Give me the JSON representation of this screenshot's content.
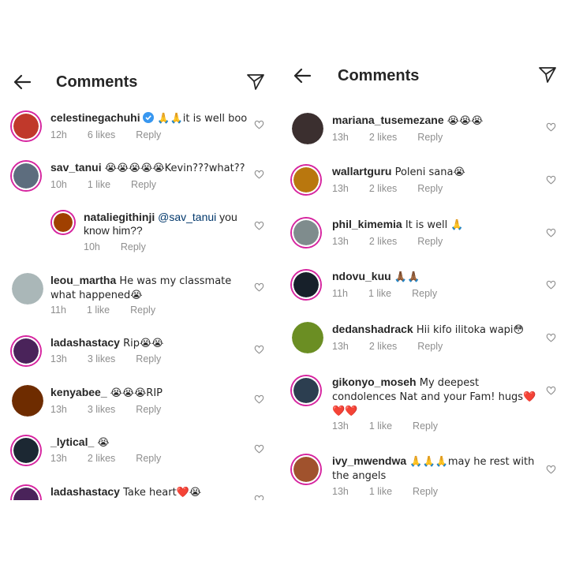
{
  "header": {
    "title": "Comments"
  },
  "left_comments": [
    {
      "user": "celestinegachuhi",
      "verified": true,
      "text": " 🙏🙏it is well boo",
      "time": "12h",
      "likes": "6 likes",
      "reply": "Reply",
      "avatar_color": "#c0392b"
    },
    {
      "user": "sav_tanui",
      "verified": false,
      "text": " 😭😭😭😭😭Kevin???what??",
      "time": "10h",
      "likes": "1 like",
      "reply": "Reply",
      "avatar_color": "#5d6d7e"
    },
    {
      "user": "nataliegithinji",
      "mention": "@sav_tanui",
      "text": " you know him??",
      "time": "10h",
      "likes": "",
      "reply": "Reply",
      "avatar_color": "#a04000"
    },
    {
      "user": "leou_martha",
      "text": " He was my classmate what happened😭",
      "time": "11h",
      "likes": "1 like",
      "reply": "Reply",
      "avatar_color": "#aab7b8"
    },
    {
      "user": "ladashastacy",
      "text": " Rip😭😭",
      "time": "13h",
      "likes": "3 likes",
      "reply": "Reply",
      "avatar_color": "#4a235a"
    },
    {
      "user": "kenyabee_",
      "text": " 😭😭😭RIP",
      "time": "13h",
      "likes": "3 likes",
      "reply": "Reply",
      "avatar_color": "#6e2c00"
    },
    {
      "user": "_lytical_",
      "text": " 😭",
      "time": "13h",
      "likes": "2 likes",
      "reply": "Reply",
      "avatar_color": "#1c2833"
    },
    {
      "user": "ladashastacy",
      "text": " Take heart❤️😭",
      "time": "",
      "likes": "",
      "reply": "",
      "avatar_color": "#4a235a"
    }
  ],
  "right_comments": [
    {
      "user": "mariana_tusemezane",
      "text": " 😭😭😭",
      "time": "13h",
      "likes": "2 likes",
      "reply": "Reply",
      "avatar_color": "#3b2f2f"
    },
    {
      "user": "wallartguru",
      "text": " Poleni sana😭",
      "time": "13h",
      "likes": "2 likes",
      "reply": "Reply",
      "avatar_color": "#b9770e"
    },
    {
      "user": "phil_kimemia",
      "text": " It is well 🙏",
      "time": "13h",
      "likes": "2 likes",
      "reply": "Reply",
      "avatar_color": "#7f8c8d"
    },
    {
      "user": "ndovu_kuu",
      "text": " 🙏🏾🙏🏾",
      "time": "11h",
      "likes": "1 like",
      "reply": "Reply",
      "avatar_color": "#17202a"
    },
    {
      "user": "dedanshadrack",
      "text": " Hii kifo ilitoka wapi😳",
      "time": "13h",
      "likes": "2 likes",
      "reply": "Reply",
      "avatar_color": "#6b8e23"
    },
    {
      "user": "gikonyo_moseh",
      "text": " My deepest condolences Nat and your Fam! hugs❤️❤️❤️",
      "time": "13h",
      "likes": "1 like",
      "reply": "Reply",
      "avatar_color": "#2c3e50"
    },
    {
      "user": "ivy_mwendwa",
      "text": " 🙏🙏🙏may he rest with the angels",
      "time": "13h",
      "likes": "1 like",
      "reply": "Reply",
      "avatar_color": "#a0522d"
    }
  ]
}
